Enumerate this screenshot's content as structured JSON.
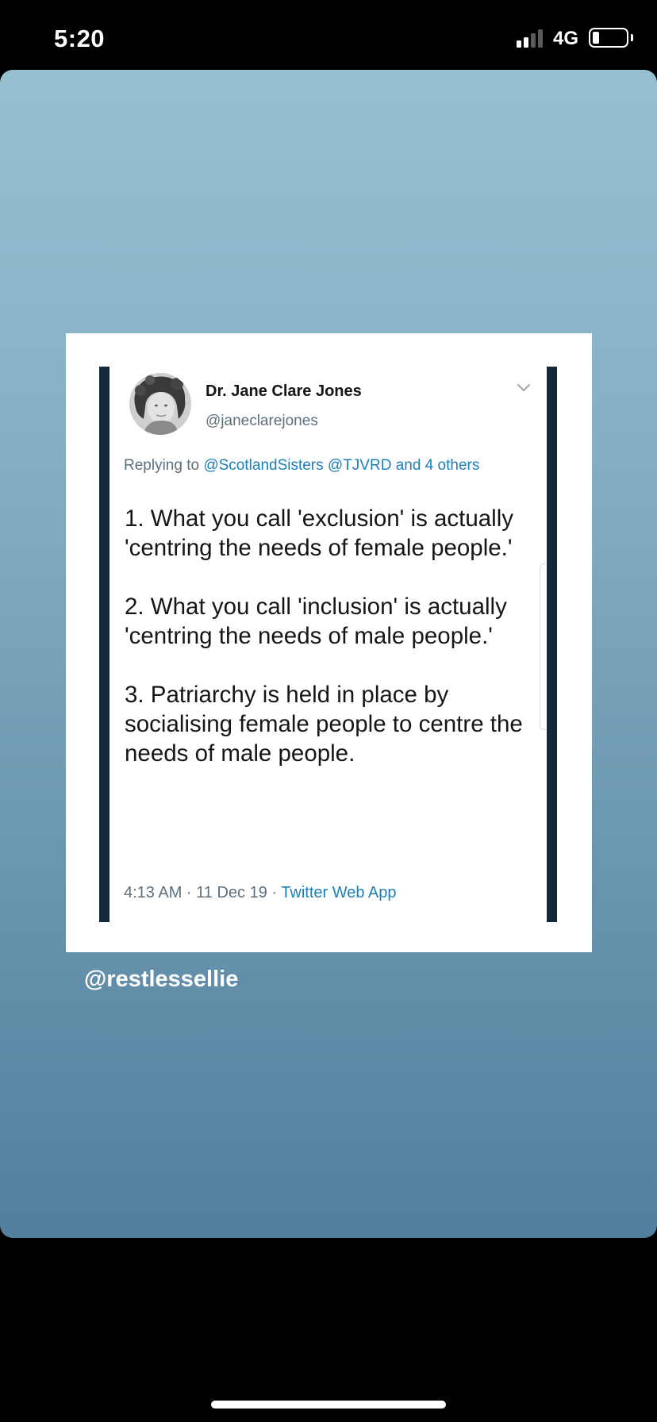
{
  "status_bar": {
    "time": "5:20",
    "network": "4G",
    "signal_bars_active": 2,
    "signal_bars_total": 4
  },
  "tweet": {
    "author_name": "Dr. Jane Clare Jones",
    "handle": "@janeclarejones",
    "reply_prefix": "Replying to",
    "reply_links": "@ScotlandSisters @TJVRD and 4 others",
    "paragraphs": [
      "1. What you call 'exclusion' is actually 'centring the needs of female people.'",
      "2. What you call 'inclusion' is actually 'centring the needs of male people.'",
      "3. Patriarchy is held in place by socialising female people to centre the needs of male people."
    ],
    "timestamp": "4:13 AM · 11 Dec 19 ·",
    "source": "Twitter Web App"
  },
  "story": {
    "mention": "@restlessellie"
  },
  "colors": {
    "card_bar": "#14283d",
    "link": "#1d7fb7",
    "secondary_text": "#5e6f7c",
    "gradient_top": "#97c0d1",
    "gradient_bottom": "#527f9e"
  },
  "icons": [
    "chevron-down-icon",
    "signal-icon",
    "battery-icon"
  ]
}
